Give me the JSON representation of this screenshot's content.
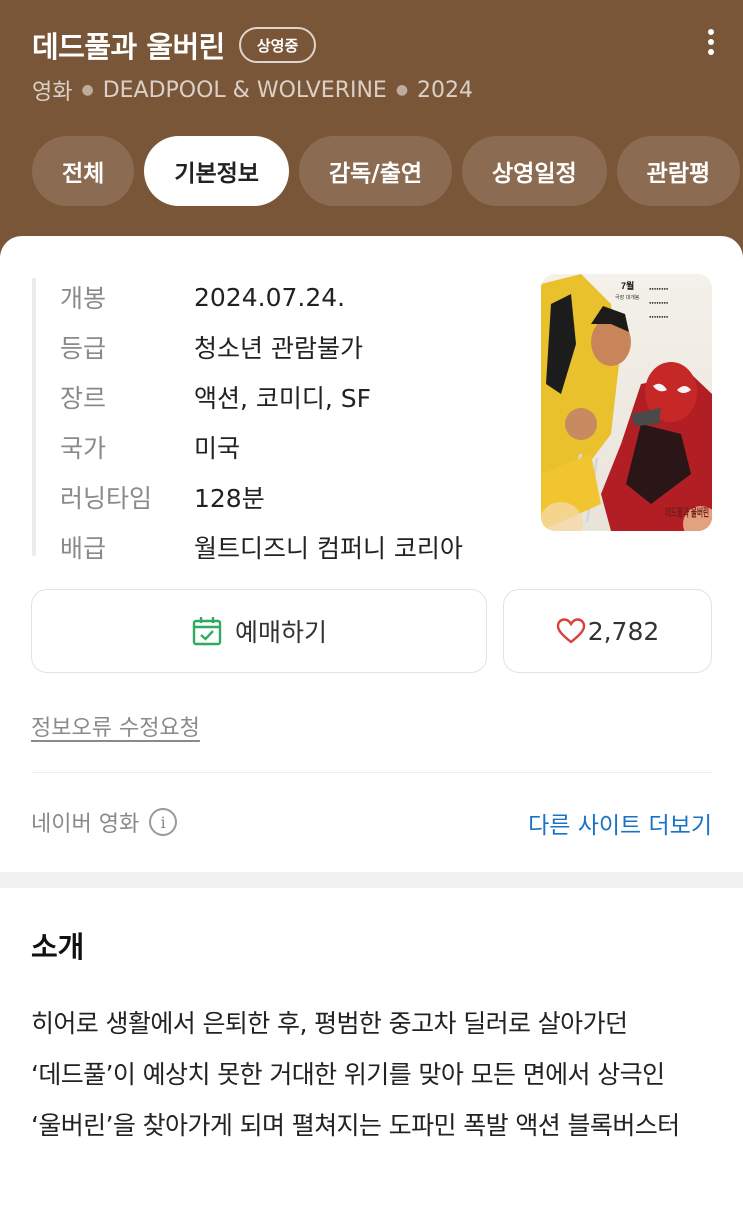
{
  "header": {
    "title": "데드풀과 울버린",
    "badge": "상영중",
    "subtitle": {
      "category": "영화",
      "original_title": "DEADPOOL & WOLVERINE",
      "year": "2024"
    },
    "tabs": [
      {
        "label": "전체",
        "active": false
      },
      {
        "label": "기본정보",
        "active": true
      },
      {
        "label": "감독/출연",
        "active": false
      },
      {
        "label": "상영일정",
        "active": false
      },
      {
        "label": "관람평",
        "active": false
      }
    ],
    "menu_icon": "kebab-menu-icon"
  },
  "info": {
    "rows": [
      {
        "label": "개봉",
        "value": "2024.07.24."
      },
      {
        "label": "등급",
        "value": "청소년 관람불가"
      },
      {
        "label": "장르",
        "value": "액션, 코미디, SF"
      },
      {
        "label": "국가",
        "value": "미국"
      },
      {
        "label": "러닝타임",
        "value": "128분"
      },
      {
        "label": "배급",
        "value": "월트디즈니 컴퍼니 코리아"
      }
    ]
  },
  "poster": {
    "date_text": "7월",
    "date_sub": "극장 대개봉",
    "logo_text": "데드풀과 울버린"
  },
  "actions": {
    "book_label": "예매하기",
    "book_icon": "calendar-check-icon",
    "like_count": "2,782",
    "like_icon": "heart-icon"
  },
  "report_link": "정보오류 수정요청",
  "source": {
    "label": "네이버 영화",
    "more_link": "다른 사이트 더보기"
  },
  "intro": {
    "title": "소개",
    "text": "히어로 생활에서 은퇴한 후, 평범한 중고차 딜러로 살아가던 ‘데드풀’이 예상치 못한 거대한 위기를 맞아 모든 면에서 상극인 ‘울버린’을 찾아가게 되며 펼쳐지는 도파민 폭발 액션 블록버스터"
  },
  "colors": {
    "header_bg": "#7a5638",
    "link": "#1a73c7",
    "book_icon": "#2dab60",
    "heart": "#d9413a"
  }
}
